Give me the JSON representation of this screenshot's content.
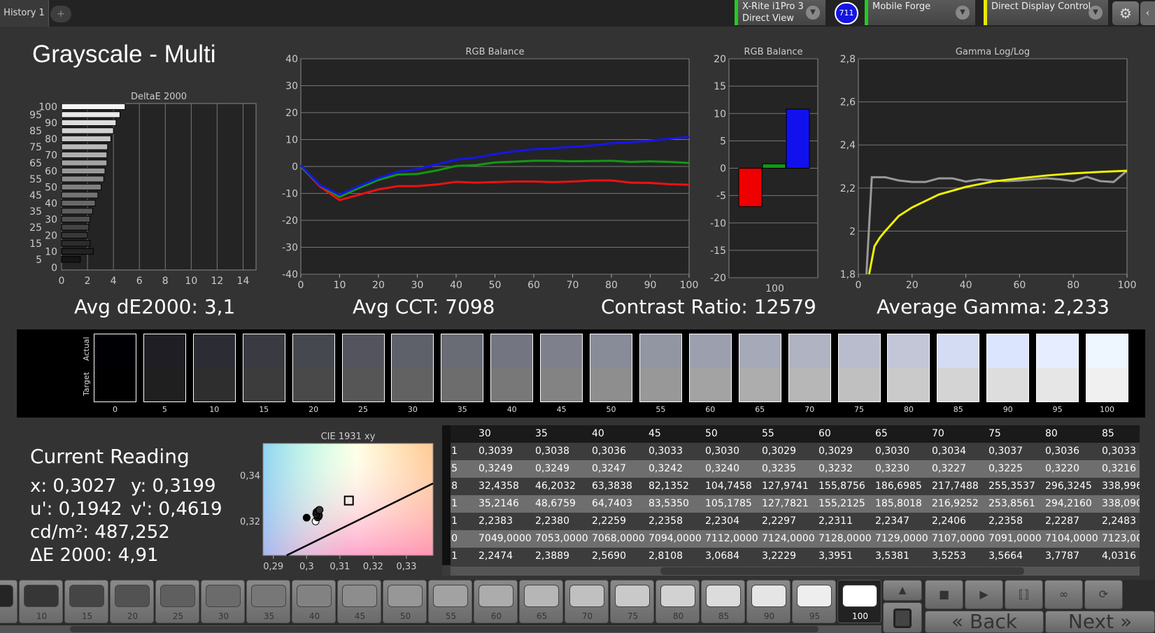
{
  "topbar": {
    "tab": "History 1",
    "add": "+",
    "meter": {
      "line1": "X-Rite i1Pro 3",
      "line2": "Direct View"
    },
    "meter_badge": "711",
    "generator": "Mobile Forge",
    "display": "Direct Display Control",
    "colors": {
      "meter": "#22cc22",
      "generator": "#22cc22",
      "display": "#e8e800",
      "badge": "#1515e0"
    }
  },
  "page_title": "Grayscale - Multi",
  "summary": {
    "de": "Avg dE2000: 3,1",
    "cct": "Avg CCT: 7098",
    "contrast": "Contrast Ratio: 12579",
    "gamma": "Average Gamma: 2,233"
  },
  "chart_data": [
    {
      "type": "bar",
      "orientation": "horizontal",
      "title": "DeltaE 2000",
      "categories": [
        0,
        5,
        10,
        15,
        20,
        25,
        30,
        35,
        40,
        45,
        50,
        55,
        60,
        65,
        70,
        75,
        80,
        85,
        90,
        95,
        100
      ],
      "values": [
        0,
        1.45,
        2.45,
        2.2,
        2.0,
        2.1,
        2.2,
        2.4,
        2.6,
        2.8,
        3.05,
        3.25,
        3.35,
        3.5,
        3.5,
        3.55,
        3.8,
        4.0,
        4.2,
        4.5,
        4.9
      ],
      "xlim": [
        0,
        15
      ],
      "xticks": [
        "0",
        "2",
        "4",
        "6",
        "8",
        "10",
        "12",
        "14"
      ],
      "yticks": [
        "0",
        "5",
        "10",
        "15",
        "20",
        "25",
        "30",
        "35",
        "40",
        "45",
        "50",
        "55",
        "60",
        "65",
        "70",
        "75",
        "80",
        "85",
        "90",
        "95",
        "100"
      ],
      "grid": true
    },
    {
      "type": "line",
      "title": "RGB Balance",
      "x": [
        0,
        5,
        10,
        15,
        20,
        25,
        30,
        35,
        40,
        45,
        50,
        55,
        60,
        65,
        70,
        75,
        80,
        85,
        90,
        95,
        100
      ],
      "series": [
        {
          "color": "#ee1111",
          "values": [
            0,
            -7.5,
            -12.5,
            -10.5,
            -8.5,
            -7.3,
            -7.3,
            -6.7,
            -5.7,
            -6,
            -5.8,
            -5.6,
            -5.6,
            -5.8,
            -5.6,
            -5.2,
            -5.2,
            -6,
            -6.1,
            -6.6,
            -6.8
          ]
        },
        {
          "color": "#119911",
          "values": [
            0,
            -7,
            -11.3,
            -8,
            -5,
            -3,
            -2.8,
            -1.5,
            0.2,
            0.5,
            1.5,
            1.8,
            2.1,
            2.1,
            1.9,
            2.0,
            2.1,
            1.7,
            1.9,
            1.7,
            1.3
          ]
        },
        {
          "color": "#1515ee",
          "values": [
            0.5,
            -7,
            -10.5,
            -7.3,
            -4.3,
            -2,
            -1,
            0.8,
            2.5,
            3.3,
            4.6,
            5.6,
            6.4,
            6.8,
            7.3,
            7.8,
            8.6,
            9,
            9.6,
            10.3,
            11
          ]
        }
      ],
      "xlim": [
        0,
        100
      ],
      "ylim": [
        -40,
        40
      ],
      "xticks": [
        "0",
        "10",
        "20",
        "30",
        "40",
        "50",
        "60",
        "70",
        "80",
        "90",
        "100"
      ],
      "yticks": [
        "-40",
        "-30",
        "-20",
        "-10",
        "0",
        "10",
        "20",
        "30",
        "40"
      ],
      "grid": true
    },
    {
      "type": "bar",
      "title": "RGB Balance",
      "categories": [
        "100"
      ],
      "series": [
        {
          "color": "#ee0000",
          "values": [
            -7
          ]
        },
        {
          "color": "#119911",
          "values": [
            0.8
          ]
        },
        {
          "color": "#1111ee",
          "values": [
            10.8
          ]
        }
      ],
      "ylim": [
        -20,
        20
      ],
      "yticks": [
        "-20",
        "-15",
        "-10",
        "-5",
        "0",
        "5",
        "10",
        "15",
        "20"
      ],
      "grid": true
    },
    {
      "type": "line",
      "title": "Gamma Log/Log",
      "series": [
        {
          "color": "#999999",
          "x": [
            3,
            5,
            10,
            15,
            20,
            25,
            30,
            35,
            40,
            45,
            50,
            55,
            60,
            65,
            70,
            75,
            80,
            85,
            90,
            95,
            100
          ],
          "values": [
            1.8,
            2.25,
            2.25,
            2.235,
            2.228,
            2.228,
            2.245,
            2.245,
            2.23,
            2.24,
            2.235,
            2.232,
            2.235,
            2.24,
            2.245,
            2.24,
            2.232,
            2.252,
            2.232,
            2.228,
            2.28
          ]
        },
        {
          "color": "#f0f000",
          "x": [
            4,
            6,
            8,
            10,
            15,
            20,
            30,
            40,
            50,
            60,
            70,
            80,
            90,
            100
          ],
          "values": [
            1.8,
            1.93,
            1.97,
            2.0,
            2.07,
            2.11,
            2.17,
            2.205,
            2.23,
            2.245,
            2.258,
            2.268,
            2.275,
            2.28
          ]
        }
      ],
      "xlim": [
        0,
        100
      ],
      "ylim": [
        1.8,
        2.8
      ],
      "xticks": [
        "0",
        "20",
        "40",
        "60",
        "80",
        "100"
      ],
      "yticks": [
        "1,8",
        "2",
        "2,2",
        "2,4",
        "2,6",
        "2,8"
      ],
      "grid": true
    },
    {
      "type": "scatter",
      "title": "CIE 1931 xy",
      "xlim": [
        0.2869,
        0.338
      ],
      "ylim": [
        0.305,
        0.354
      ],
      "xticks": [
        "0,29",
        "0,3",
        "0,31",
        "0,32",
        "0,33"
      ],
      "yticks": [
        "0,32",
        "0,34"
      ],
      "target": [
        0.3127,
        0.329
      ],
      "points": [
        [
          0.3,
          0.3215
        ],
        [
          0.3027,
          0.3199
        ],
        [
          0.3033,
          0.3216
        ],
        [
          0.3036,
          0.322
        ],
        [
          0.3037,
          0.3225
        ],
        [
          0.3034,
          0.3227
        ],
        [
          0.303,
          0.323
        ],
        [
          0.3029,
          0.3232
        ],
        [
          0.303,
          0.324
        ],
        [
          0.3033,
          0.3242
        ],
        [
          0.3036,
          0.3247
        ],
        [
          0.3038,
          0.3249
        ],
        [
          0.3039,
          0.3249
        ]
      ],
      "locus": [
        [
          0.294,
          0.305
        ],
        [
          0.338,
          0.3365
        ]
      ]
    }
  ],
  "swatches": {
    "actual_label": "Actual",
    "target_label": "Target",
    "levels": [
      "0",
      "5",
      "10",
      "15",
      "20",
      "25",
      "30",
      "35",
      "40",
      "45",
      "50",
      "55",
      "60",
      "65",
      "70",
      "75",
      "80",
      "85",
      "90",
      "95",
      "100"
    ]
  },
  "current_reading": {
    "title": "Current Reading",
    "x": "x: 0,3027",
    "y": "y: 0,3199",
    "u": "u': 0,1942",
    "v": "v': 0,4619",
    "lum": "cd/m²: 487,252",
    "de": "ΔE 2000: 4,91"
  },
  "table": {
    "headers": [
      "",
      "30",
      "35",
      "40",
      "45",
      "50",
      "55",
      "60",
      "65",
      "70",
      "75",
      "80",
      "85"
    ],
    "rows": [
      [
        "1",
        "0,3039",
        "0,3038",
        "0,3036",
        "0,3033",
        "0,3030",
        "0,3029",
        "0,3029",
        "0,3030",
        "0,3034",
        "0,3037",
        "0,3036",
        "0,3033"
      ],
      [
        "5",
        "0,3249",
        "0,3249",
        "0,3247",
        "0,3242",
        "0,3240",
        "0,3235",
        "0,3232",
        "0,3230",
        "0,3227",
        "0,3225",
        "0,3220",
        "0,3216"
      ],
      [
        "58",
        "32,4358",
        "46,2032",
        "63,3838",
        "82,1352",
        "104,7458",
        "127,9741",
        "155,8756",
        "186,6985",
        "217,7488",
        "255,3537",
        "296,3245",
        "338,996"
      ],
      [
        "11",
        "35,2146",
        "48,6759",
        "64,7403",
        "83,5350",
        "105,1785",
        "127,7821",
        "155,2125",
        "185,8018",
        "216,9252",
        "253,8561",
        "294,2160",
        "338,090"
      ],
      [
        "1",
        "2,2383",
        "2,2380",
        "2,2259",
        "2,2358",
        "2,2304",
        "2,2297",
        "2,2311",
        "2,2347",
        "2,2406",
        "2,2358",
        "2,2287",
        "2,2483"
      ],
      [
        "0000",
        "7049,0000",
        "7053,0000",
        "7068,0000",
        "7094,0000",
        "7112,0000",
        "7124,0000",
        "7128,0000",
        "7129,0000",
        "7107,0000",
        "7091,0000",
        "7104,0000",
        "7123,00"
      ],
      [
        "1",
        "2,2474",
        "2,3889",
        "2,5690",
        "2,8108",
        "3,0684",
        "3,2229",
        "3,3951",
        "3,5381",
        "3,5253",
        "3,5664",
        "3,7787",
        "4,0316"
      ]
    ]
  },
  "patches": {
    "levels": [
      "5",
      "10",
      "15",
      "20",
      "25",
      "30",
      "35",
      "40",
      "45",
      "50",
      "55",
      "60",
      "65",
      "70",
      "75",
      "80",
      "85",
      "90",
      "95",
      "100"
    ],
    "selected": "100"
  },
  "nav": {
    "back": "Back",
    "next": "Next",
    "back_icon": "«",
    "next_icon": "»",
    "icons": [
      "stop-icon",
      "play-icon",
      "step-icon",
      "loop-icon",
      "refresh-icon"
    ]
  }
}
